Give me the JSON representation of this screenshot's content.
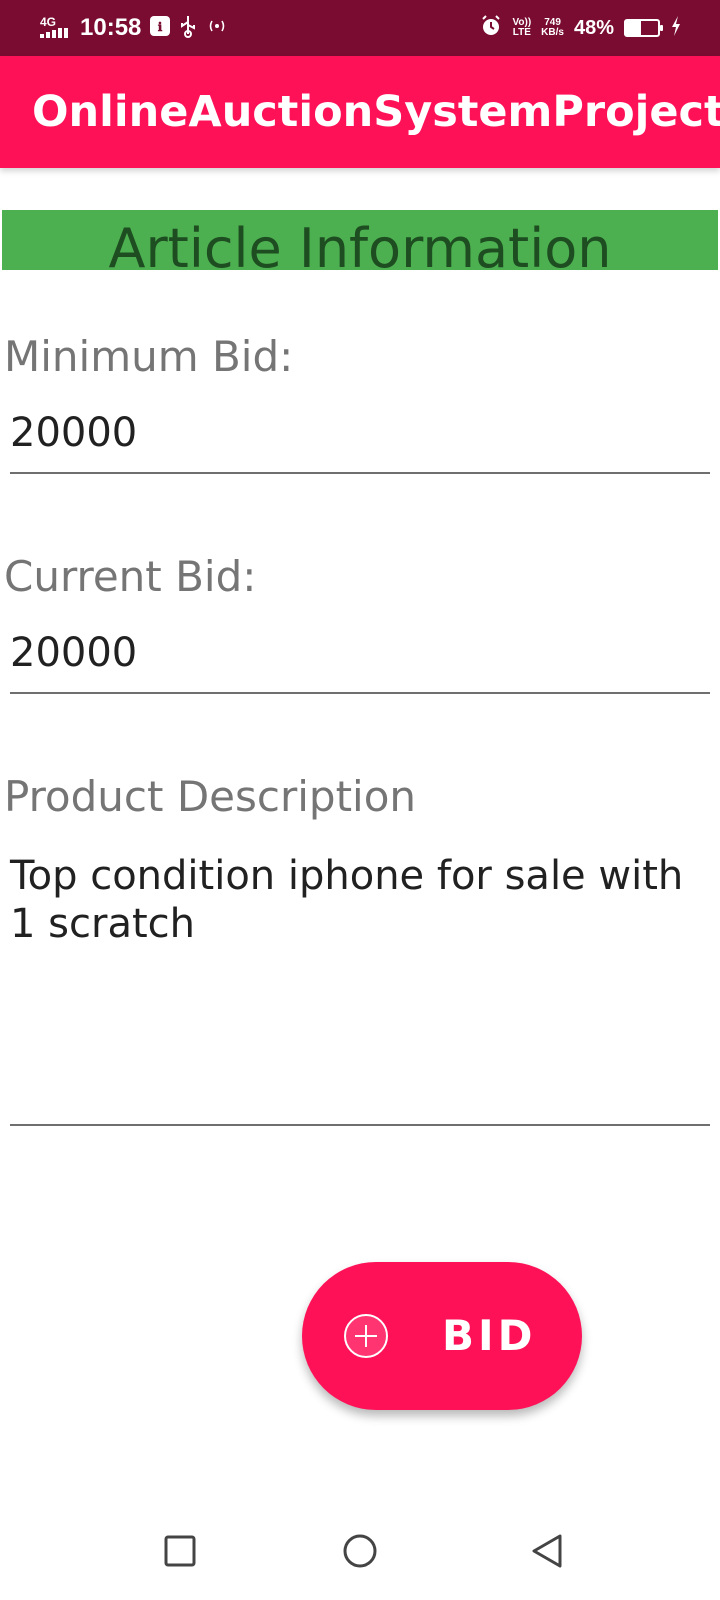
{
  "status_bar": {
    "network": "4G",
    "time": "10:58",
    "data_speed_value": "749",
    "data_speed_unit": "KB/s",
    "volte_top": "Vo))",
    "volte_bottom": "LTE",
    "battery_percent": "48%",
    "battery_level": 0.48,
    "icons": [
      "signal-icon",
      "usb-debug-icon",
      "usb-icon",
      "hotspot-icon",
      "alarm-icon",
      "battery-icon",
      "charging-icon"
    ]
  },
  "app_bar": {
    "title": "OnlineAuctionSystemProject"
  },
  "article": {
    "header": "Article Information",
    "minimum_bid_label": "Minimum Bid:",
    "minimum_bid_value": "20000",
    "current_bid_label": "Current Bid:",
    "current_bid_value": "20000",
    "description_label": "Product Description",
    "description_value": "Top condition iphone for sale with 1 scratch"
  },
  "fab": {
    "label": "BID",
    "icon": "add-circle-icon"
  },
  "nav_bar": {
    "buttons": [
      "recents-icon",
      "home-icon",
      "back-icon"
    ]
  },
  "colors": {
    "status_bar": "#7a0c31",
    "accent": "#ff1158",
    "header_green": "#4caf50",
    "header_text": "#1d4d20",
    "label_gray": "#757575"
  }
}
